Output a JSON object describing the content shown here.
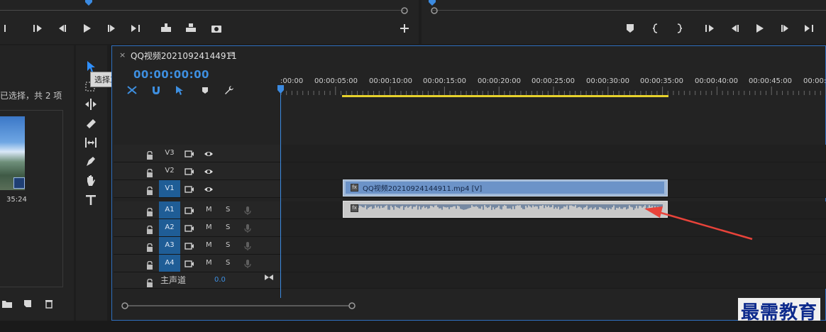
{
  "project": {
    "selection_text": "已选择，共 2 项",
    "clip_duration": "35:24"
  },
  "tools": {
    "tooltip": "选择工具 (V)"
  },
  "timeline": {
    "sequence_title": "QQ视频20210924144911",
    "close_glyph": "×",
    "menu_glyph": "≡",
    "timecode": "00:00:00:00",
    "ruler_labels": [
      ":00:00",
      "00:00:05:00",
      "00:00:10:00",
      "00:00:15:00",
      "00:00:20:00",
      "00:00:25:00",
      "00:00:30:00",
      "00:00:35:00",
      "00:00:40:00",
      "00:00:45:00",
      "00:00:5"
    ],
    "video_tracks": [
      "V3",
      "V2",
      "V1"
    ],
    "audio_tracks": [
      "A1",
      "A2",
      "A3",
      "A4"
    ],
    "mute_label": "M",
    "solo_label": "S",
    "master_label": "主声道",
    "master_value": "0.0",
    "video_clip_label": "QQ视频20210924144911.mp4 [V]",
    "fx_label": "fx"
  },
  "watermark": "最需教育",
  "colors": {
    "accent": "#3e8fe0",
    "workarea": "#e7d22c",
    "arrow": "#e8433a"
  }
}
